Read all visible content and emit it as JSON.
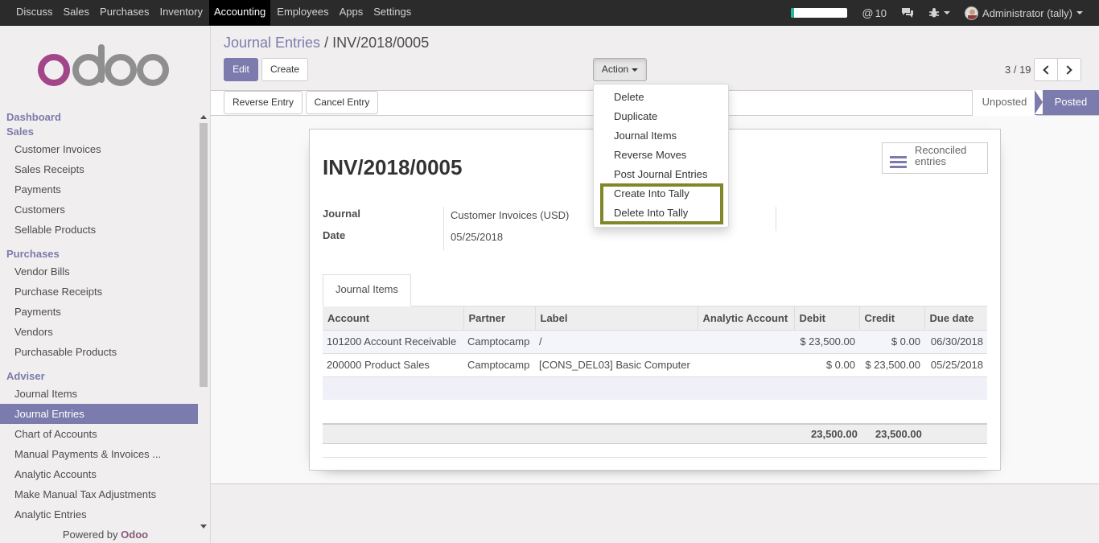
{
  "topbar": {
    "menus": [
      "Discuss",
      "Sales",
      "Purchases",
      "Inventory",
      "Accounting",
      "Employees",
      "Apps",
      "Settings"
    ],
    "active_menu": "Accounting",
    "progress_fraction": 0.05,
    "mentions_count": "10",
    "user": "Administrator (tally)"
  },
  "sidebar": {
    "sections": [
      {
        "title": "Dashboard",
        "items": []
      },
      {
        "title": "Sales",
        "items": [
          "Customer Invoices",
          "Sales Receipts",
          "Payments",
          "Customers",
          "Sellable Products"
        ]
      },
      {
        "title": "Purchases",
        "items": [
          "Vendor Bills",
          "Purchase Receipts",
          "Payments",
          "Vendors",
          "Purchasable Products"
        ]
      },
      {
        "title": "Adviser",
        "items": [
          "Journal Items",
          "Journal Entries",
          "Chart of Accounts",
          "Manual Payments & Invoices ...",
          "Analytic Accounts",
          "Make Manual Tax Adjustments",
          "Analytic Entries"
        ]
      }
    ],
    "active_item": "Journal Entries",
    "powered_prefix": "Powered by",
    "powered_brand": "Odoo"
  },
  "breadcrumb": {
    "parent": "Journal Entries",
    "separator": "/",
    "current": "INV/2018/0005"
  },
  "buttons": {
    "edit": "Edit",
    "create": "Create",
    "action": "Action",
    "reverse_entry": "Reverse Entry",
    "cancel_entry": "Cancel Entry"
  },
  "pager": {
    "value": "3 / 19"
  },
  "status": {
    "unposted": "Unposted",
    "posted": "Posted",
    "current": "Posted"
  },
  "action_menu": {
    "items": [
      "Delete",
      "Duplicate",
      "Journal Items",
      "Reverse Moves",
      "Post Journal Entries",
      "Create Into Tally",
      "Delete Into Tally"
    ],
    "highlighted": [
      "Create Into Tally",
      "Delete Into Tally"
    ],
    "highlight_color": "#80862a"
  },
  "form": {
    "title": "INV/2018/0005",
    "smart_button": {
      "line1": "Reconciled",
      "line2": "entries"
    },
    "fields": [
      {
        "label": "Journal",
        "value": "Customer Invoices (USD)"
      },
      {
        "label": "Date",
        "value": "05/25/2018"
      }
    ],
    "tab": "Journal Items",
    "table": {
      "columns": [
        "Account",
        "Partner",
        "Label",
        "Analytic Account",
        "Debit",
        "Credit",
        "Due date"
      ],
      "rows": [
        [
          "101200 Account Receivable",
          "Camptocamp",
          "/",
          "",
          "$ 23,500.00",
          "$ 0.00",
          "06/30/2018"
        ],
        [
          "200000 Product Sales",
          "Camptocamp",
          "[CONS_DEL03] Basic Computer",
          "",
          "$ 0.00",
          "$ 23,500.00",
          "05/25/2018"
        ]
      ],
      "totals": {
        "debit": "23,500.00",
        "credit": "23,500.00"
      }
    }
  },
  "colors": {
    "accent": "#7c7bad",
    "brand": "#875a7b",
    "topbar": "#2b2b2b"
  }
}
